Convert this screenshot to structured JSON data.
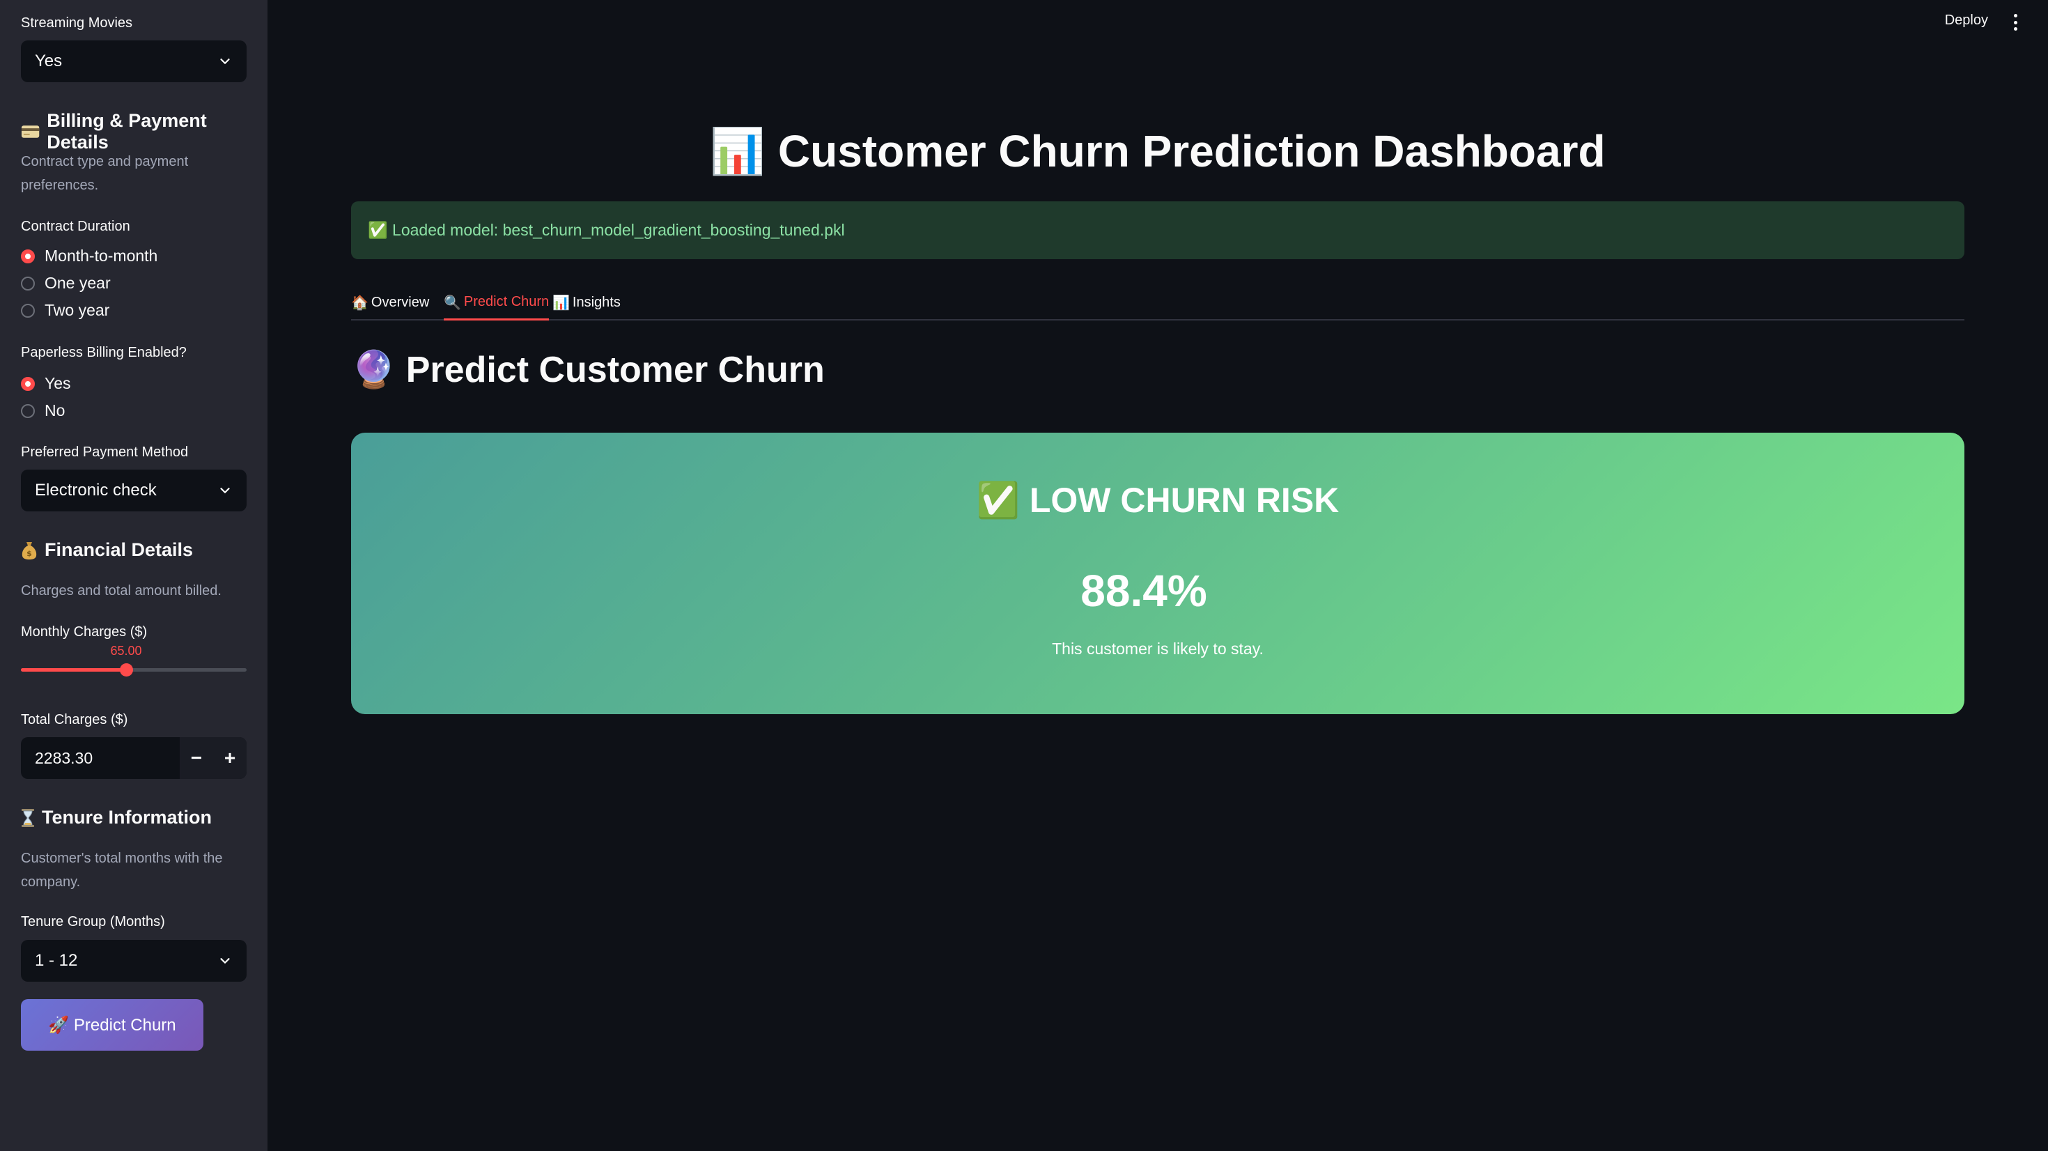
{
  "sidebar": {
    "streaming_movies": {
      "label": "Streaming Movies",
      "value": "Yes"
    },
    "billing": {
      "heading_icon": "credit-card-icon",
      "heading": "Billing & Payment Details",
      "caption": "Contract type and payment preferences.",
      "contract": {
        "label": "Contract Duration",
        "options": [
          "Month-to-month",
          "One year",
          "Two year"
        ],
        "selected": "Month-to-month"
      },
      "paperless": {
        "label": "Paperless Billing Enabled?",
        "options": [
          "Yes",
          "No"
        ],
        "selected": "Yes"
      },
      "payment": {
        "label": "Preferred Payment Method",
        "value": "Electronic check"
      }
    },
    "financial": {
      "heading_icon": "money-bag-icon",
      "heading": "Financial Details",
      "caption": "Charges and total amount billed.",
      "monthly": {
        "label": "Monthly Charges ($)",
        "value": "65.00",
        "fraction": 0.465
      },
      "total": {
        "label": "Total Charges ($)",
        "value": "2283.30",
        "minus": "−",
        "plus": "+"
      }
    },
    "tenure": {
      "heading_icon": "hourglass-icon",
      "heading": "Tenure Information",
      "caption": "Customer's total months with the company.",
      "group": {
        "label": "Tenure Group (Months)",
        "value": "1 - 12"
      }
    },
    "predict_button": "🚀 Predict Churn"
  },
  "header": {
    "deploy": "Deploy",
    "menu_icon": "kebab-menu-icon"
  },
  "main": {
    "title_icon": "📊",
    "title": "Customer Churn Prediction Dashboard",
    "alert": "✅ Loaded model: best_churn_model_gradient_boosting_tuned.pkl",
    "tabs": [
      {
        "icon": "🏠",
        "label": "Overview"
      },
      {
        "icon": "🔍",
        "label": "Predict Churn"
      },
      {
        "icon": "📊",
        "label": "Insights"
      }
    ],
    "active_tab": "Predict Churn",
    "subheading_icon": "🔮",
    "subheading": "Predict Customer Churn",
    "result": {
      "risk_icon": "✅",
      "risk": "LOW CHURN RISK",
      "probability": "88.4%",
      "message": "This customer is likely to stay."
    }
  },
  "colors": {
    "accent": "#ff4b4b",
    "background": "#0e1117",
    "sidebar": "#262730",
    "success_text": "#8be0a4",
    "result_gradient_start": "#4a9e98",
    "result_gradient_end": "#7ae687",
    "button_gradient_start": "#6b73d6",
    "button_gradient_end": "#7a58b8"
  }
}
